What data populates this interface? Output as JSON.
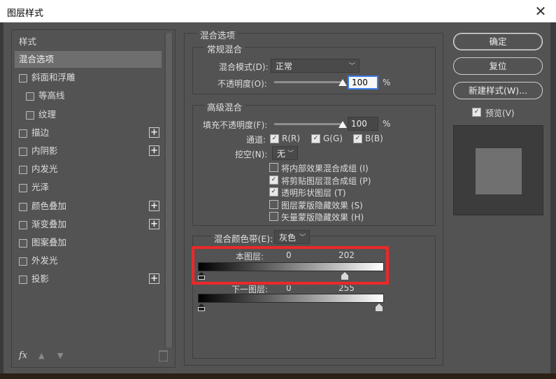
{
  "window": {
    "title": "图层样式",
    "close_glyph": "✕"
  },
  "styles_panel": {
    "header": "样式",
    "items": [
      {
        "label": "混合选项",
        "checkbox": false,
        "selected": true,
        "plus": false
      },
      {
        "label": "斜面和浮雕",
        "checkbox": true,
        "checked": false,
        "plus": false
      },
      {
        "label": "等高线",
        "checkbox": true,
        "checked": false,
        "plus": false,
        "indent": true
      },
      {
        "label": "纹理",
        "checkbox": true,
        "checked": false,
        "plus": false,
        "indent": true
      },
      {
        "label": "描边",
        "checkbox": true,
        "checked": false,
        "plus": true
      },
      {
        "label": "内阴影",
        "checkbox": true,
        "checked": false,
        "plus": true
      },
      {
        "label": "内发光",
        "checkbox": true,
        "checked": false,
        "plus": false
      },
      {
        "label": "光泽",
        "checkbox": true,
        "checked": false,
        "plus": false
      },
      {
        "label": "颜色叠加",
        "checkbox": true,
        "checked": false,
        "plus": true
      },
      {
        "label": "渐变叠加",
        "checkbox": true,
        "checked": false,
        "plus": true
      },
      {
        "label": "图案叠加",
        "checkbox": true,
        "checked": false,
        "plus": false
      },
      {
        "label": "外发光",
        "checkbox": true,
        "checked": false,
        "plus": false
      },
      {
        "label": "投影",
        "checkbox": true,
        "checked": false,
        "plus": true
      }
    ],
    "plus_glyph": "+",
    "footer": {
      "fx_label": "fx",
      "up_glyph": "▲",
      "down_glyph": "▼"
    }
  },
  "blending_options": {
    "title": "混合选项",
    "general": {
      "title": "常规混合",
      "blend_mode_label": "混合模式(D):",
      "blend_mode_value": "正常",
      "opacity_label": "不透明度(O):",
      "opacity_value": "100",
      "opacity_unit": "%",
      "opacity_level": 1.0
    },
    "advanced": {
      "title": "高级混合",
      "fill_opacity_label": "填充不透明度(F):",
      "fill_opacity_value": "100",
      "fill_opacity_unit": "%",
      "fill_opacity_level": 1.0,
      "channels_label": "通道:",
      "channels": [
        {
          "label": "R(R)",
          "checked": true
        },
        {
          "label": "G(G)",
          "checked": true
        },
        {
          "label": "B(B)",
          "checked": true
        }
      ],
      "knockout_label": "挖空(N):",
      "knockout_value": "无",
      "options": [
        {
          "label": "将内部效果混合成组 (I)",
          "checked": false
        },
        {
          "label": "将剪贴图层混合成组 (P)",
          "checked": true
        },
        {
          "label": "透明形状图层 (T)",
          "checked": true
        },
        {
          "label": "图层蒙版隐藏效果 (S)",
          "checked": false
        },
        {
          "label": "矢量蒙版隐藏效果 (H)",
          "checked": false
        }
      ]
    },
    "blend_if": {
      "label": "混合颜色带(E):",
      "value": "灰色",
      "this_layer_label": "本图层:",
      "this_layer_low": "0",
      "this_layer_high": "202",
      "this_layer_high_level": 0.79,
      "underlying_label": "下一图层:",
      "underlying_low": "0",
      "underlying_high": "255"
    }
  },
  "buttons": {
    "ok": "确定",
    "reset": "复位",
    "new_style": "新建样式(W)...",
    "preview_label": "预览(V)",
    "preview_checked": true
  },
  "colors": {
    "panel_bg": "#535353",
    "highlight_red": "#ea2929",
    "focus_blue": "#3b7de9"
  }
}
